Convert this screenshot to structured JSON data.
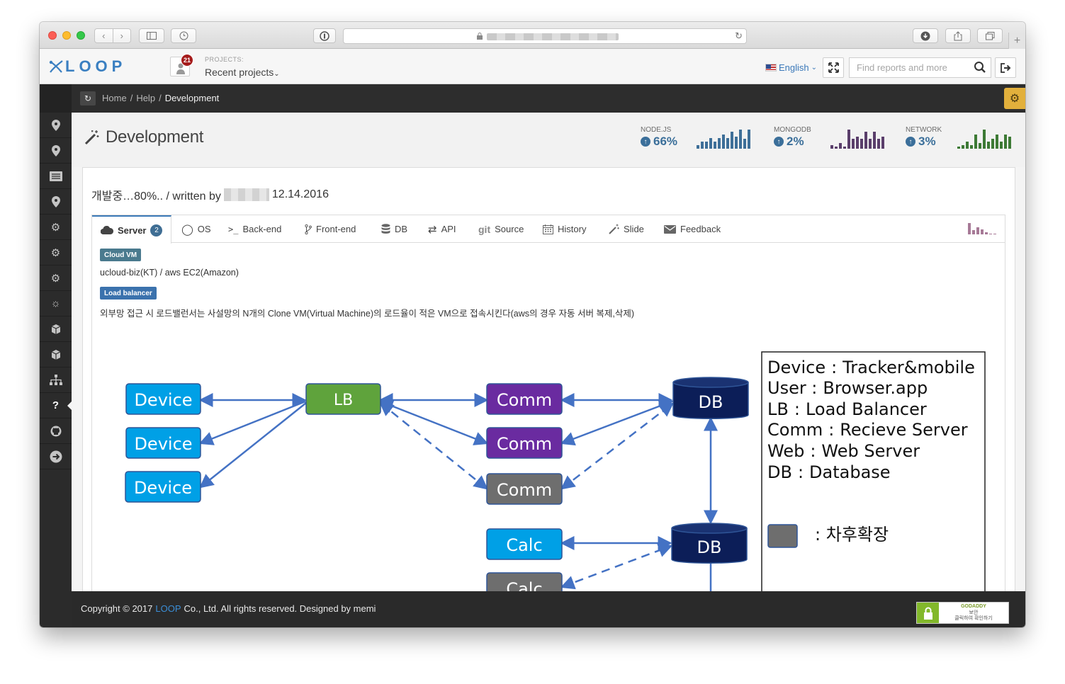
{
  "browser": {
    "plus_tab": "+"
  },
  "header": {
    "logo": "LOOP",
    "notification_count": "21",
    "projects_label": "PROJECTS:",
    "projects_value": "Recent projects",
    "language": "English",
    "search_placeholder": "Find reports and more"
  },
  "breadcrumb": {
    "items": [
      "Home",
      "Help",
      "Development"
    ],
    "separator": "/"
  },
  "page": {
    "title": "Development"
  },
  "stats": [
    {
      "label": "NODE.JS",
      "value": "66%",
      "bars": [
        3,
        6,
        6,
        9,
        6,
        9,
        12,
        9,
        14,
        10,
        16,
        8,
        16
      ],
      "color": "#3e6f98"
    },
    {
      "label": "MONGODB",
      "value": "2%",
      "bars": [
        3,
        2,
        5,
        2,
        16,
        8,
        10,
        8,
        14,
        8,
        14,
        8,
        10
      ],
      "color": "#5a3e6b"
    },
    {
      "label": "NETWORK",
      "value": "3%",
      "bars": [
        2,
        3,
        6,
        3,
        12,
        5,
        16,
        6,
        8,
        12,
        6,
        12,
        10
      ],
      "color": "#3d7a35"
    }
  ],
  "article": {
    "title_prefix": "개발중…80%.. / written by",
    "date": "12.14.2016"
  },
  "tabs": [
    {
      "label": "Server",
      "icon": "cloud-icon",
      "count": "2",
      "active": true
    },
    {
      "label": "OS",
      "icon": "circle-icon"
    },
    {
      "label": "Back-end",
      "icon": "terminal-icon"
    },
    {
      "label": "Front-end",
      "icon": "branch-icon"
    },
    {
      "label": "DB",
      "icon": "database-icon"
    },
    {
      "label": "API",
      "icon": "exchange-icon"
    },
    {
      "label": "Source",
      "icon": "git-icon"
    },
    {
      "label": "History",
      "icon": "calendar-icon"
    },
    {
      "label": "Slide",
      "icon": "magic-wand-icon"
    },
    {
      "label": "Feedback",
      "icon": "envelope-icon"
    }
  ],
  "server": {
    "tag1": "Cloud VM",
    "tag1_color": "#4a7a8e",
    "line1": "ucloud-biz(KT) / aws EC2(Amazon)",
    "tag2": "Load balancer",
    "tag2_color": "#3b72ad",
    "line2": "외부망 접근 시 로드밸런서는 사설망의 N개의 Clone VM(Virtual Machine)의 로드율이 적은 VM으로 접속시킨다(aws의 경우 자동 서버 복제,삭제)"
  },
  "diagram": {
    "devices": [
      "Device",
      "Device",
      "Device"
    ],
    "lb": "LB",
    "comms": [
      "Comm",
      "Comm",
      "Comm"
    ],
    "calcs": [
      "Calc",
      "Calc"
    ],
    "dbs": [
      "DB",
      "DB"
    ],
    "legend": [
      {
        "key": "Device",
        "value": "Tracker&mobile"
      },
      {
        "key": "User",
        "value": "Browser.app"
      },
      {
        "key": "LB",
        "value": "Load Balancer"
      },
      {
        "key": "Comm",
        "value": "Recieve Server"
      },
      {
        "key": "Web",
        "value": "Web Server"
      },
      {
        "key": "DB",
        "value": "Database"
      }
    ],
    "legend_sep": ":",
    "future_label": ": 차후확장",
    "colors": {
      "device": "#00a0e6",
      "lb": "#5fa33c",
      "comm": "#6a2ba0",
      "future": "#6e6e6e",
      "db": "#0c1e58",
      "arrow": "#4472c4"
    }
  },
  "footer": {
    "copyright_prefix": "Copyright © 2017",
    "brand": "LOOP",
    "copyright_suffix": "Co., Ltd. All rights reserved. Designed by  memi",
    "seal_title": "GODADDY",
    "seal_line1": "보안",
    "seal_line2": "클릭하여 확인하기"
  }
}
